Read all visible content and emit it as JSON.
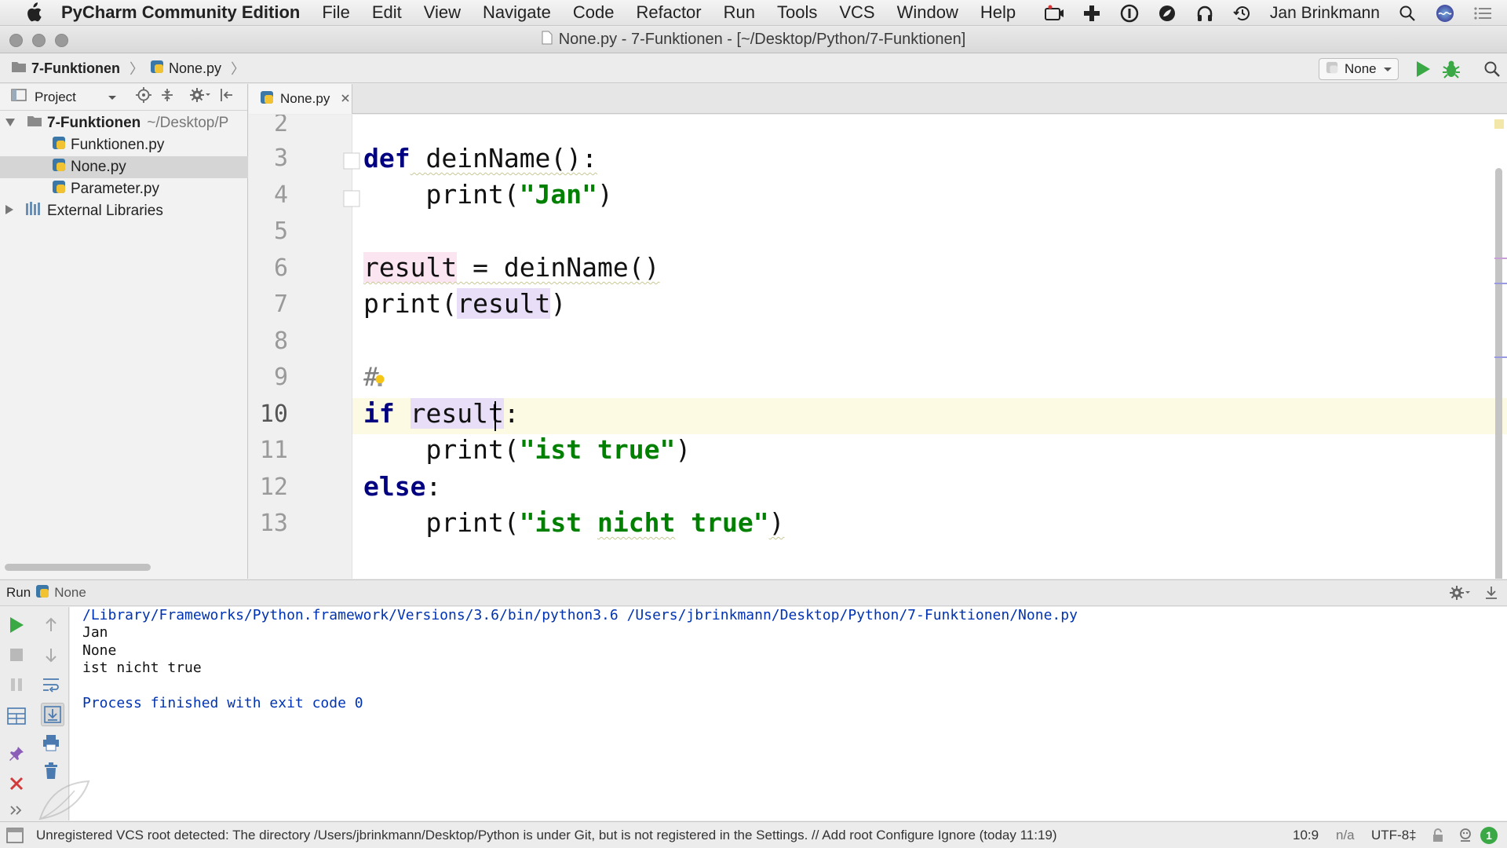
{
  "menubar": {
    "app_name": "PyCharm Community Edition",
    "items": [
      "File",
      "Edit",
      "View",
      "Navigate",
      "Code",
      "Refactor",
      "Run",
      "Tools",
      "VCS",
      "Window",
      "Help"
    ],
    "user": "Jan Brinkmann"
  },
  "window": {
    "title": "None.py - 7-Funktionen - [~/Desktop/Python/7-Funktionen]"
  },
  "navbar": {
    "crumbs": [
      "7-Funktionen",
      "None.py"
    ],
    "run_config": "None"
  },
  "project": {
    "header": "Project",
    "root_name": "7-Funktionen",
    "root_path": "~/Desktop/P",
    "files": [
      "Funktionen.py",
      "None.py",
      "Parameter.py"
    ],
    "external": "External Libraries"
  },
  "editor": {
    "tab": "None.py",
    "line_numbers": [
      "2",
      "3",
      "4",
      "5",
      "6",
      "7",
      "8",
      "9",
      "10",
      "11",
      "12",
      "13"
    ],
    "current_line": "10"
  },
  "code": {
    "l3_kw": "def",
    "l3_rest": " deinName():",
    "l4_fn": "    print(",
    "l4_str": "\"Jan\"",
    "l4_end": ")",
    "l6_var": "result",
    "l6_rest": " = deinName()",
    "l7_fn": "print(",
    "l7_var": "result",
    "l7_end": ")",
    "l9_comment": "#",
    "l10_kw": "if",
    "l10_var": "result",
    "l10_end": ":",
    "l11_fn": "    print(",
    "l11_str": "\"ist true\"",
    "l11_end": ")",
    "l12_kw": "else",
    "l12_end": ":",
    "l13_fn": "    print(",
    "l13_str1": "\"ist ",
    "l13_str2": "nicht",
    "l13_str3": " true\"",
    "l13_end": ")"
  },
  "run_panel": {
    "label": "Run",
    "config": "None",
    "console": [
      "/Library/Frameworks/Python.framework/Versions/3.6/bin/python3.6 /Users/jbrinkmann/Desktop/Python/7-Funktionen/None.py",
      "Jan",
      "None",
      "ist nicht true",
      "",
      "Process finished with exit code 0"
    ]
  },
  "statusbar": {
    "message": "Unregistered VCS root detected: The directory /Users/jbrinkmann/Desktop/Python is under Git, but is not registered in the Settings. // Add root  Configure  Ignore (today 11:19)",
    "position": "10:9",
    "na": "n/a",
    "encoding": "UTF-8‡",
    "notifications": "1"
  },
  "colors": {
    "keyword": "#000080",
    "string": "#008000",
    "current_line": "#fcfae2",
    "run_green": "#3aa845",
    "stop_red": "#d23a3a"
  }
}
